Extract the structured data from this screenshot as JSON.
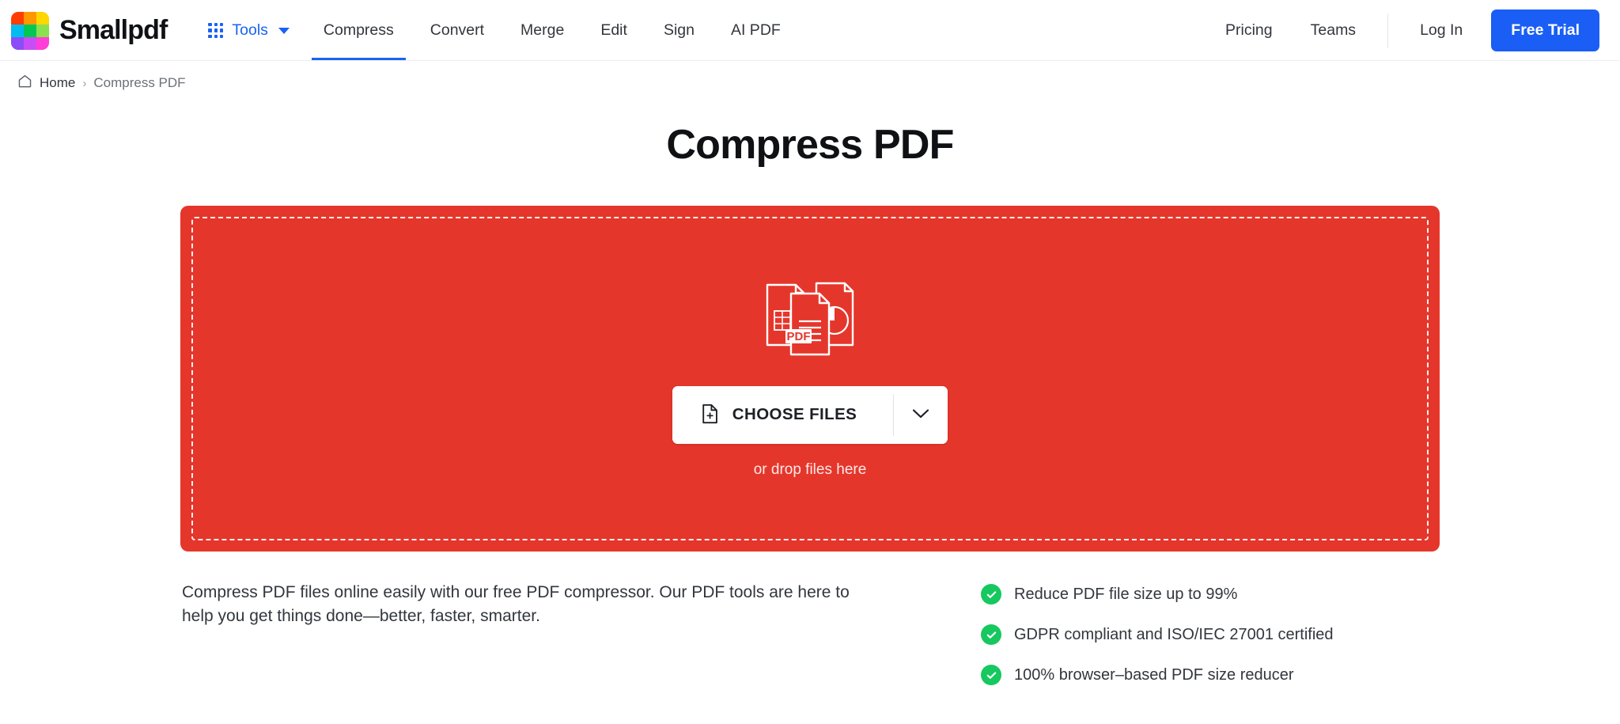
{
  "header": {
    "brand_name": "Smallpdf",
    "logo_colors": [
      "#FF3D00",
      "#FF9800",
      "#FFD600",
      "#00BCEF",
      "#00C853",
      "#8BE04E",
      "#8B4DF5",
      "#C94DF5",
      "#FF3DD8"
    ],
    "tools_label": "Tools",
    "nav_items": [
      {
        "label": "Compress",
        "active": true
      },
      {
        "label": "Convert",
        "active": false
      },
      {
        "label": "Merge",
        "active": false
      },
      {
        "label": "Edit",
        "active": false
      },
      {
        "label": "Sign",
        "active": false
      },
      {
        "label": "AI PDF",
        "active": false
      }
    ],
    "right_links": [
      {
        "label": "Pricing"
      },
      {
        "label": "Teams"
      }
    ],
    "login_label": "Log In",
    "trial_label": "Free Trial",
    "accent_color": "#1a5ef5"
  },
  "breadcrumb": {
    "home_label": "Home",
    "separator": "›",
    "current_label": "Compress PDF"
  },
  "page": {
    "title": "Compress PDF"
  },
  "dropzone": {
    "choose_files_label": "CHOOSE FILES",
    "drop_hint": "or drop files here",
    "pdf_badge": "PDF",
    "background_color": "#e5362b"
  },
  "description": {
    "text": "Compress PDF files online easily with our free PDF compressor. Our PDF tools are here to help you get things done—better, faster, smarter."
  },
  "features": {
    "check_color": "#16c85f",
    "items": [
      {
        "label": "Reduce PDF file size up to 99%"
      },
      {
        "label": "GDPR compliant and ISO/IEC 27001 certified"
      },
      {
        "label": "100% browser–based PDF size reducer"
      }
    ]
  }
}
